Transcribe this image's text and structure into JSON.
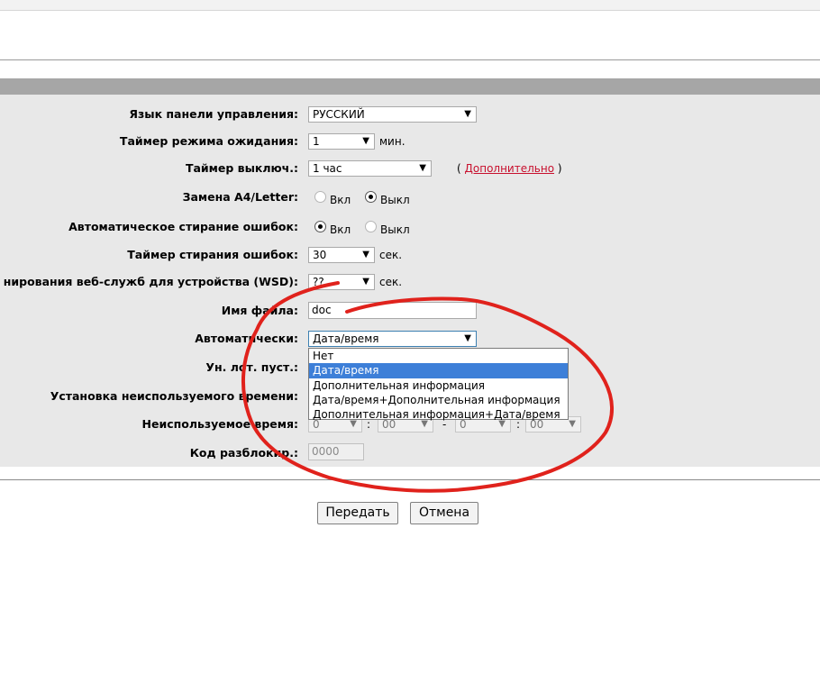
{
  "settings": {
    "language": {
      "label": "Язык панели управления:",
      "value": "РУССКИЙ"
    },
    "sleep_timer": {
      "label": "Таймер режима ожидания:",
      "value": "1",
      "unit": "мин."
    },
    "power_off_timer": {
      "label": "Таймер выключ.:",
      "value": "1 час",
      "link_prefix": "(",
      "link": "Дополнительно",
      "link_suffix": ")"
    },
    "a4_letter": {
      "label": "Замена A4/Letter:",
      "on": "Вкл",
      "off": "Выкл",
      "selected": "off"
    },
    "auto_error_clear": {
      "label": "Автоматическое стирание ошибок:",
      "on": "Вкл",
      "off": "Выкл",
      "selected": "on"
    },
    "error_clear_timer": {
      "label": "Таймер стирания ошибок:",
      "value": "30",
      "unit": "сек."
    },
    "wsd_timer": {
      "label": "нирования веб-служб для устройства (WSD):",
      "value": "??",
      "unit": "сек."
    },
    "file_name": {
      "label": "Имя файла:",
      "value": "doc"
    },
    "auto": {
      "label": "Автоматически:",
      "value": "Дата/время"
    },
    "empty_lot": {
      "label": "Ун. лот. пуст.:"
    },
    "unused_time_setting": {
      "label": "Установка неиспользуемого времени:"
    },
    "unused_time": {
      "label": "Неиспользуемое время:",
      "h1": "0",
      "m1": "00",
      "dash": "-",
      "h2": "0",
      "m2": "00",
      "colon": ":"
    },
    "unlock_code": {
      "label": "Код разблокир.:",
      "value": "0000"
    }
  },
  "dropdown_options": [
    "Нет",
    "Дата/время",
    "Дополнительная информация",
    "Дата/время+Дополнительная информация",
    "Дополнительная информация+Дата/время"
  ],
  "dropdown_selected_index": 1,
  "buttons": {
    "submit": "Передать",
    "cancel": "Отмена"
  },
  "icons": {
    "select_arrow": "▼"
  },
  "colors": {
    "header_bar": "#a6a6a6",
    "panel_bg": "#e8e8e8",
    "link": "#c8102e",
    "selected_option": "#3d7fd8",
    "annotation": "#e0221c"
  }
}
